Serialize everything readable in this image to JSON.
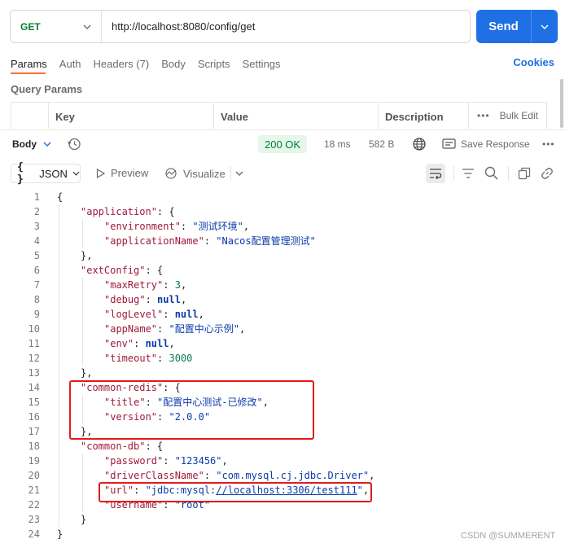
{
  "request": {
    "method": "GET",
    "url": "http://localhost:8080/config/get",
    "send_label": "Send"
  },
  "tabs": [
    {
      "label": "Params",
      "active": true
    },
    {
      "label": "Auth"
    },
    {
      "label": "Headers (7)"
    },
    {
      "label": "Body"
    },
    {
      "label": "Scripts"
    },
    {
      "label": "Settings"
    }
  ],
  "cookies_label": "Cookies",
  "query_params": {
    "title": "Query Params",
    "columns": [
      "Key",
      "Value",
      "Description"
    ],
    "bulk_edit_label": "Bulk Edit"
  },
  "response": {
    "body_label": "Body",
    "status": "200 OK",
    "time": "18 ms",
    "size": "582 B",
    "save_label": "Save Response",
    "format": "JSON",
    "preview_label": "Preview",
    "visualize_label": "Visualize"
  },
  "code_lines": [
    {
      "n": "1",
      "indent": 0,
      "t": [
        [
          "p",
          "{"
        ]
      ]
    },
    {
      "n": "2",
      "indent": 1,
      "t": [
        [
          "k",
          "\"application\""
        ],
        [
          "p",
          ": {"
        ]
      ]
    },
    {
      "n": "3",
      "indent": 2,
      "t": [
        [
          "k",
          "\"environment\""
        ],
        [
          "p",
          ": "
        ],
        [
          "s",
          "\"测试环境\""
        ],
        [
          "p",
          ","
        ]
      ]
    },
    {
      "n": "4",
      "indent": 2,
      "t": [
        [
          "k",
          "\"applicationName\""
        ],
        [
          "p",
          ": "
        ],
        [
          "s",
          "\"Nacos配置管理测试\""
        ]
      ]
    },
    {
      "n": "5",
      "indent": 1,
      "t": [
        [
          "p",
          "},"
        ]
      ]
    },
    {
      "n": "6",
      "indent": 1,
      "t": [
        [
          "k",
          "\"extConfig\""
        ],
        [
          "p",
          ": {"
        ]
      ]
    },
    {
      "n": "7",
      "indent": 2,
      "t": [
        [
          "k",
          "\"maxRetry\""
        ],
        [
          "p",
          ": "
        ],
        [
          "n",
          "3"
        ],
        [
          "p",
          ","
        ]
      ]
    },
    {
      "n": "8",
      "indent": 2,
      "t": [
        [
          "k",
          "\"debug\""
        ],
        [
          "p",
          ": "
        ],
        [
          "kw",
          "null"
        ],
        [
          "p",
          ","
        ]
      ]
    },
    {
      "n": "9",
      "indent": 2,
      "t": [
        [
          "k",
          "\"logLevel\""
        ],
        [
          "p",
          ": "
        ],
        [
          "kw",
          "null"
        ],
        [
          "p",
          ","
        ]
      ]
    },
    {
      "n": "10",
      "indent": 2,
      "t": [
        [
          "k",
          "\"appName\""
        ],
        [
          "p",
          ": "
        ],
        [
          "s",
          "\"配置中心示例\""
        ],
        [
          "p",
          ","
        ]
      ]
    },
    {
      "n": "11",
      "indent": 2,
      "t": [
        [
          "k",
          "\"env\""
        ],
        [
          "p",
          ": "
        ],
        [
          "kw",
          "null"
        ],
        [
          "p",
          ","
        ]
      ]
    },
    {
      "n": "12",
      "indent": 2,
      "t": [
        [
          "k",
          "\"timeout\""
        ],
        [
          "p",
          ": "
        ],
        [
          "n",
          "3000"
        ]
      ]
    },
    {
      "n": "13",
      "indent": 1,
      "t": [
        [
          "p",
          "},"
        ]
      ]
    },
    {
      "n": "14",
      "indent": 1,
      "t": [
        [
          "k",
          "\"common-redis\""
        ],
        [
          "p",
          ": {"
        ]
      ]
    },
    {
      "n": "15",
      "indent": 2,
      "t": [
        [
          "k",
          "\"title\""
        ],
        [
          "p",
          ": "
        ],
        [
          "s",
          "\"配置中心测试-已修改\""
        ],
        [
          "p",
          ","
        ]
      ]
    },
    {
      "n": "16",
      "indent": 2,
      "t": [
        [
          "k",
          "\"version\""
        ],
        [
          "p",
          ": "
        ],
        [
          "s",
          "\"2.0.0\""
        ]
      ]
    },
    {
      "n": "17",
      "indent": 1,
      "t": [
        [
          "p",
          "},"
        ]
      ]
    },
    {
      "n": "18",
      "indent": 1,
      "t": [
        [
          "k",
          "\"common-db\""
        ],
        [
          "p",
          ": {"
        ]
      ]
    },
    {
      "n": "19",
      "indent": 2,
      "t": [
        [
          "k",
          "\"password\""
        ],
        [
          "p",
          ": "
        ],
        [
          "s",
          "\"123456\""
        ],
        [
          "p",
          ","
        ]
      ]
    },
    {
      "n": "20",
      "indent": 2,
      "t": [
        [
          "k",
          "\"driverClassName\""
        ],
        [
          "p",
          ": "
        ],
        [
          "s",
          "\"com.mysql.cj.jdbc.Driver\""
        ],
        [
          "p",
          ","
        ]
      ]
    },
    {
      "n": "21",
      "indent": 2,
      "t": [
        [
          "k",
          "\"url\""
        ],
        [
          "p",
          ": "
        ],
        [
          "s",
          "\"jdbc:mysql:"
        ],
        [
          "su",
          "//localhost:3306/test111"
        ],
        [
          "s",
          "\""
        ],
        [
          "p",
          ","
        ]
      ]
    },
    {
      "n": "22",
      "indent": 2,
      "t": [
        [
          "k",
          "\"username\""
        ],
        [
          "p",
          ": "
        ],
        [
          "s",
          "\"root\""
        ]
      ]
    },
    {
      "n": "23",
      "indent": 1,
      "t": [
        [
          "p",
          "}"
        ]
      ]
    },
    {
      "n": "24",
      "indent": 0,
      "t": [
        [
          "p",
          "}"
        ]
      ]
    }
  ],
  "watermark": "CSDN @SUMMERENT",
  "colors": {
    "accent": "#1f6fe5",
    "status_ok": "#007f31",
    "highlight": "#e31b1b",
    "tab_active": "#ff6c37"
  }
}
